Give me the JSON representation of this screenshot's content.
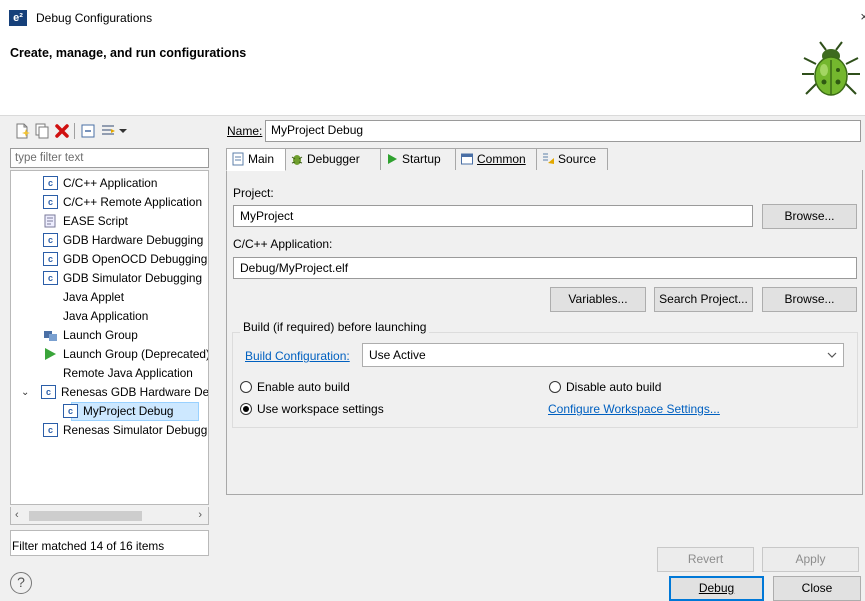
{
  "window": {
    "title": "Debug Configurations",
    "close_glyph": "×",
    "logo_text": "e²"
  },
  "header": {
    "subtitle": "Create, manage, and run configurations"
  },
  "left": {
    "filter_placeholder": "type filter text",
    "tree": [
      {
        "label": "C/C++ Application",
        "icon": "c-icon",
        "indent": 1
      },
      {
        "label": "C/C++ Remote Application",
        "icon": "c-icon",
        "indent": 1
      },
      {
        "label": "EASE Script",
        "icon": "script-icon",
        "indent": 1
      },
      {
        "label": "GDB Hardware Debugging",
        "icon": "c-icon",
        "indent": 1
      },
      {
        "label": "GDB OpenOCD Debugging",
        "icon": "c-icon",
        "indent": 1
      },
      {
        "label": "GDB Simulator Debugging",
        "icon": "c-icon",
        "indent": 1
      },
      {
        "label": "Java Applet",
        "icon": "",
        "indent": 1
      },
      {
        "label": "Java Application",
        "icon": "",
        "indent": 1
      },
      {
        "label": "Launch Group",
        "icon": "launch-group-icon",
        "indent": 1
      },
      {
        "label": "Launch Group (Deprecated)",
        "icon": "run-icon",
        "indent": 1
      },
      {
        "label": "Remote Java Application",
        "icon": "",
        "indent": 1
      },
      {
        "label": "Renesas GDB Hardware Debugging",
        "icon": "c-icon",
        "indent": 0
      },
      {
        "label": "MyProject Debug",
        "icon": "c-icon",
        "indent": 2
      },
      {
        "label": "Renesas Simulator Debugging",
        "icon": "c-icon",
        "indent": 1
      }
    ],
    "status": "Filter matched 14 of 16 items"
  },
  "name": {
    "label": "Name:",
    "value": "MyProject Debug"
  },
  "tabs": [
    {
      "label": "Main",
      "icon": "document-icon"
    },
    {
      "label": "Debugger",
      "icon": "bug-small-icon"
    },
    {
      "label": "Startup",
      "icon": "run-icon"
    },
    {
      "label": "Common",
      "icon": "common-icon"
    },
    {
      "label": "Source",
      "icon": "source-icon"
    }
  ],
  "main": {
    "project_label": "Project:",
    "project_value": "MyProject",
    "browse": "Browse...",
    "app_label": "C/C++ Application:",
    "app_value": "Debug/MyProject.elf",
    "variables": "Variables...",
    "search_project": "Search Project...",
    "build_group_title": "Build (if required) before launching",
    "build_config_link": "Build Configuration:",
    "build_config_value": "Use Active",
    "enable_auto_build": "Enable auto build",
    "disable_auto_build": "Disable auto build",
    "use_workspace": "Use workspace settings",
    "configure_workspace": "Configure Workspace Settings..."
  },
  "buttons": {
    "revert": "Revert",
    "apply": "Apply",
    "debug": "Debug",
    "close": "Close"
  }
}
